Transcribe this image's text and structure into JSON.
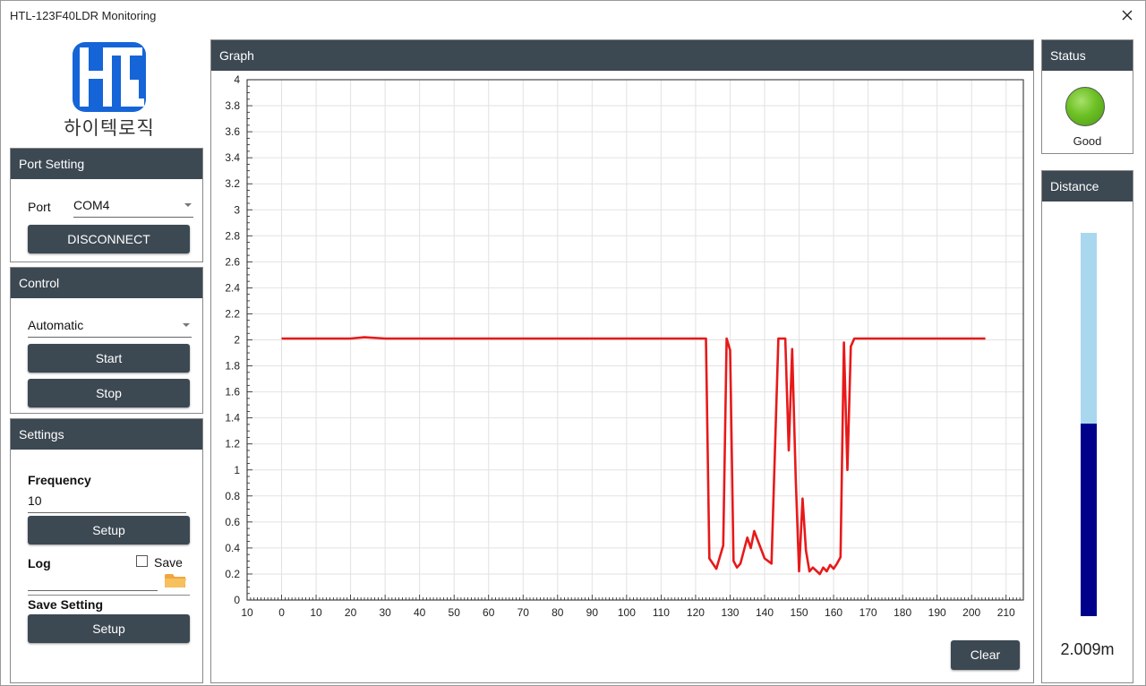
{
  "window": {
    "title": "HTL-123F40LDR Monitoring"
  },
  "logo": {
    "text": "하이텍로직"
  },
  "port_setting": {
    "header": "Port Setting",
    "port_label": "Port",
    "port_value": "COM4",
    "disconnect_label": "DISCONNECT"
  },
  "control": {
    "header": "Control",
    "mode_value": "Automatic",
    "start_label": "Start",
    "stop_label": "Stop"
  },
  "settings": {
    "header": "Settings",
    "frequency_label": "Frequency",
    "frequency_value": "10",
    "frequency_setup_label": "Setup",
    "log_label": "Log",
    "save_label": "Save",
    "save_checked": false,
    "save_setting_label": "Save Setting",
    "save_setting_setup_label": "Setup",
    "folder_icon": "folder-icon"
  },
  "graph": {
    "header": "Graph",
    "clear_label": "Clear"
  },
  "status": {
    "header": "Status",
    "text": "Good",
    "led_color": "#6cc024"
  },
  "distance": {
    "header": "Distance",
    "value_text": "2.009m",
    "fill_fraction": 0.502,
    "fill_color": "#00008b",
    "bg_color": "#a9d8ee"
  },
  "chart_data": {
    "type": "line",
    "title": "",
    "xlabel": "",
    "ylabel": "",
    "xlim": [
      -10,
      215
    ],
    "ylim": [
      0,
      4
    ],
    "x_ticks": [
      -10,
      0,
      10,
      20,
      30,
      40,
      50,
      60,
      70,
      80,
      90,
      100,
      110,
      120,
      130,
      140,
      150,
      160,
      170,
      180,
      190,
      200,
      210
    ],
    "x_tick_labels": [
      "10",
      "0",
      "10",
      "20",
      "30",
      "40",
      "50",
      "60",
      "70",
      "80",
      "90",
      "100",
      "110",
      "120",
      "130",
      "140",
      "150",
      "160",
      "170",
      "180",
      "190",
      "200",
      "210"
    ],
    "y_ticks": [
      0,
      0.2,
      0.4,
      0.6,
      0.8,
      1,
      1.2,
      1.4,
      1.6,
      1.8,
      2,
      2.2,
      2.4,
      2.6,
      2.8,
      3,
      3.2,
      3.4,
      3.6,
      3.8,
      4
    ],
    "y_tick_labels": [
      "0",
      "0.2",
      "0.4",
      "0.6",
      "0.8",
      "1",
      "1.2",
      "1.4",
      "1.6",
      "1.8",
      "2",
      "2.2",
      "2.4",
      "2.6",
      "2.8",
      "3",
      "3.2",
      "3.4",
      "3.6",
      "3.8",
      "4"
    ],
    "grid": true,
    "series": [
      {
        "color": "#e8191a",
        "x": [
          0,
          10,
          20,
          24,
          30,
          40,
          50,
          60,
          70,
          80,
          90,
          100,
          110,
          120,
          123,
          124,
          126,
          128,
          129,
          130,
          131,
          132,
          133,
          135,
          136,
          137,
          140,
          142,
          144,
          146,
          147,
          148,
          149,
          150,
          151,
          152,
          153,
          154,
          156,
          157,
          158,
          159,
          160,
          161,
          162,
          163,
          164,
          165,
          166,
          167,
          170,
          180,
          190,
          200,
          204
        ],
        "y": [
          2.01,
          2.01,
          2.01,
          2.02,
          2.01,
          2.01,
          2.01,
          2.01,
          2.01,
          2.01,
          2.01,
          2.01,
          2.01,
          2.01,
          2.01,
          0.32,
          0.24,
          0.42,
          2.01,
          1.92,
          0.3,
          0.25,
          0.28,
          0.48,
          0.4,
          0.53,
          0.32,
          0.28,
          2.01,
          2.01,
          1.15,
          1.93,
          0.95,
          0.22,
          0.78,
          0.38,
          0.22,
          0.25,
          0.2,
          0.25,
          0.22,
          0.27,
          0.24,
          0.28,
          0.33,
          1.98,
          1.0,
          1.95,
          2.01,
          2.01,
          2.01,
          2.01,
          2.01,
          2.01,
          2.01
        ]
      }
    ]
  }
}
